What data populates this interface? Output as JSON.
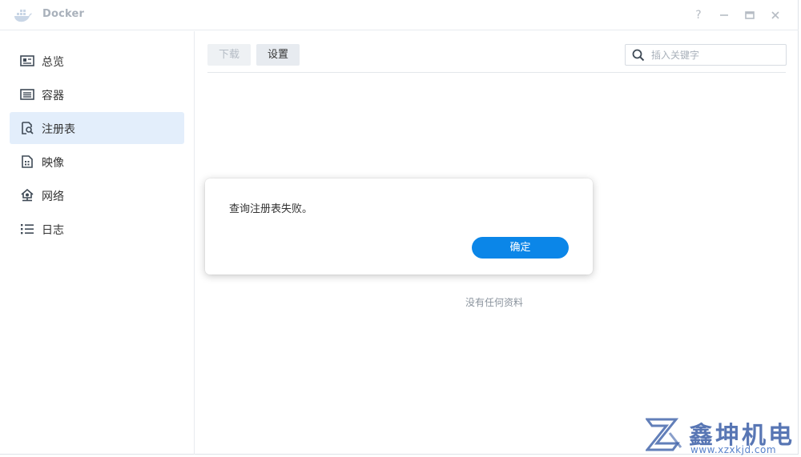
{
  "window": {
    "title": "Docker",
    "help_symbol": "?"
  },
  "sidebar": {
    "items": [
      {
        "label": "总览",
        "icon": "overview-icon"
      },
      {
        "label": "容器",
        "icon": "container-icon"
      },
      {
        "label": "注册表",
        "icon": "registry-icon",
        "active": true
      },
      {
        "label": "映像",
        "icon": "image-icon"
      },
      {
        "label": "网络",
        "icon": "network-icon"
      },
      {
        "label": "日志",
        "icon": "log-list-icon"
      }
    ]
  },
  "toolbar": {
    "download_label": "下载",
    "settings_label": "设置",
    "search_placeholder": "插入关键字"
  },
  "main": {
    "empty_text": "没有任何资料"
  },
  "dialog": {
    "message": "查询注册表失败。",
    "ok_label": "确定"
  },
  "watermark": {
    "name": "鑫坤机电",
    "url": "www.xzxkjd.com"
  },
  "colors": {
    "accent": "#0b86e8",
    "active_nav_bg": "#e3eefb",
    "watermark": "#3b5fa8"
  }
}
